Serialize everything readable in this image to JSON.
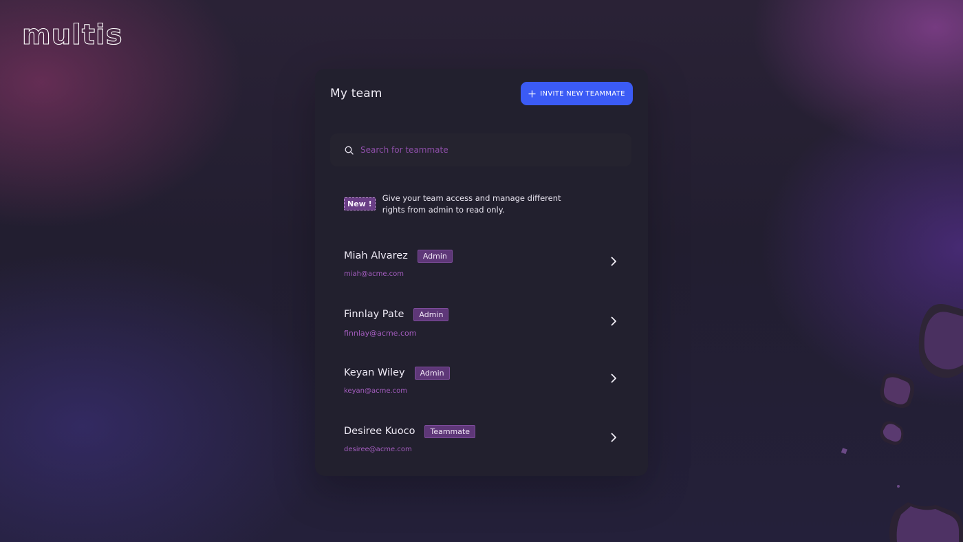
{
  "brand": {
    "logo_text": "multis"
  },
  "team": {
    "title": "My team",
    "invite_label": "INVITE NEW TEAMMATE",
    "search_placeholder": "Search for teammate",
    "notice": {
      "badge": "New !",
      "text": "Give your team access and manage different rights from admin to read only."
    },
    "members": [
      {
        "name": "Miah Alvarez",
        "role": "Admin",
        "email": "miah@acme.com"
      },
      {
        "name": "Finnlay Pate",
        "role": "Admin",
        "email": "finnlay@acme.com"
      },
      {
        "name": "Keyan Wiley",
        "role": "Admin",
        "email": "keyan@acme.com"
      },
      {
        "name": "Desiree Kuoco",
        "role": "Teammate",
        "email": "desiree@acme.com"
      }
    ]
  },
  "colors": {
    "accent": "#3B5BF5",
    "badge": "#5E3778",
    "email": "#A45DBF",
    "card": "#22202E"
  },
  "icons": [
    "plus-icon",
    "search-icon",
    "chevron-right-icon"
  ]
}
